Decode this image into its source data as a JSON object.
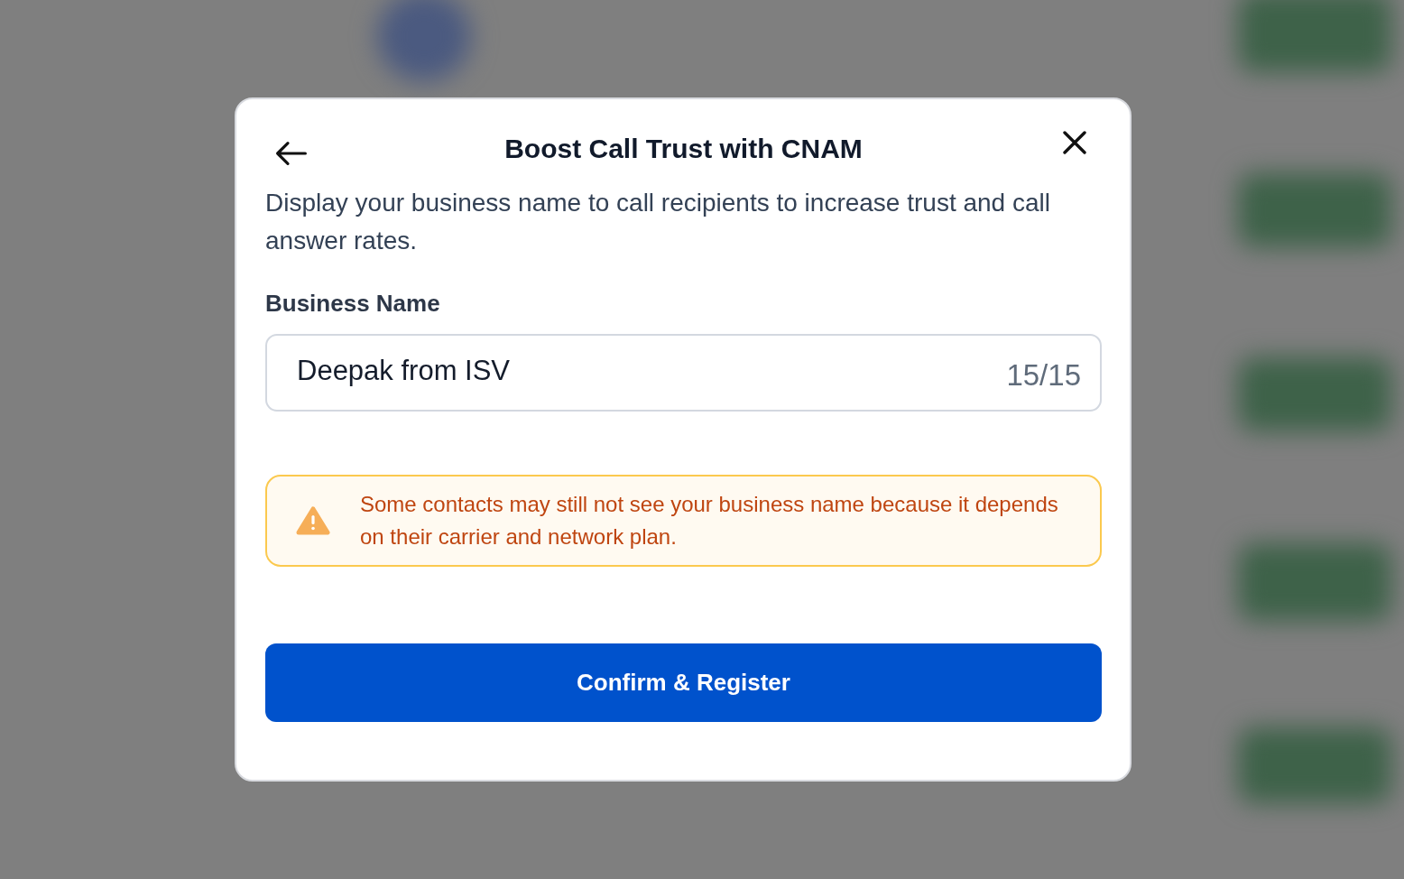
{
  "dialog": {
    "title": "Boost Call Trust with CNAM",
    "description": "Display your business name to call recipients to increase trust and call answer rates.",
    "business_name_field": {
      "label": "Business Name",
      "value": "Deepak from ISV",
      "counter": "15/15"
    },
    "warning": {
      "text": "Some contacts may still not see your business name because it depends on their carrier and network plan."
    },
    "primary_button": {
      "label": "Confirm & Register"
    }
  }
}
